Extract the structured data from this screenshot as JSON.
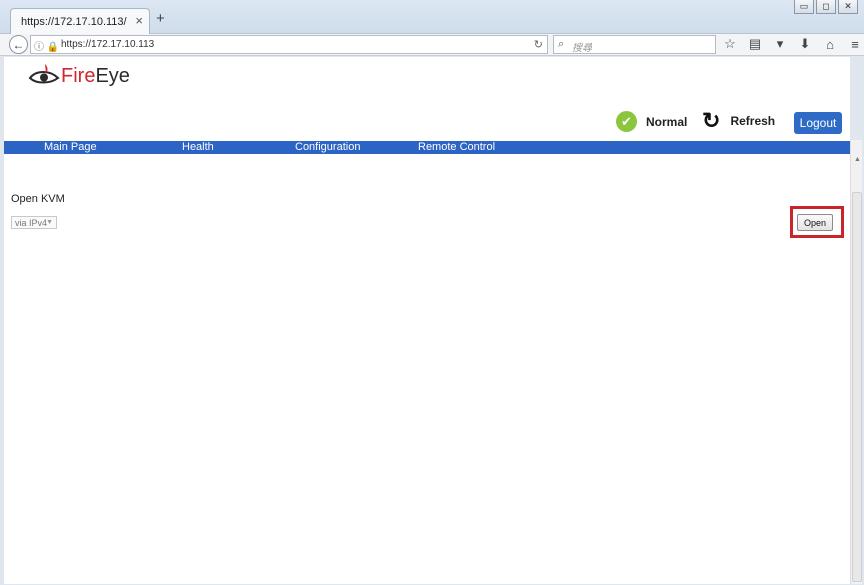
{
  "browser": {
    "tab_title": "https://172.17.10.113/",
    "tab_close": "×",
    "new_tab": "+",
    "url": "https://172.17.10.113",
    "search_placeholder": "搜尋",
    "window_controls": [
      "minimize",
      "restore",
      "close"
    ]
  },
  "header": {
    "logo_fire": "Fire",
    "logo_eye": "Eye",
    "status_label": "Normal",
    "refresh_label": "Refresh",
    "logout_label": "Logout"
  },
  "menu": {
    "items": [
      "Main Page",
      "Health",
      "Configuration",
      "Remote Control"
    ]
  },
  "main": {
    "section_title": "Open KVM",
    "select_value": "via IPv4",
    "open_label": "Open"
  },
  "colors": {
    "accent_blue": "#2b64c4",
    "status_green": "#8cc63f",
    "highlight_red": "#c8242a",
    "logo_red": "#d2272e"
  }
}
